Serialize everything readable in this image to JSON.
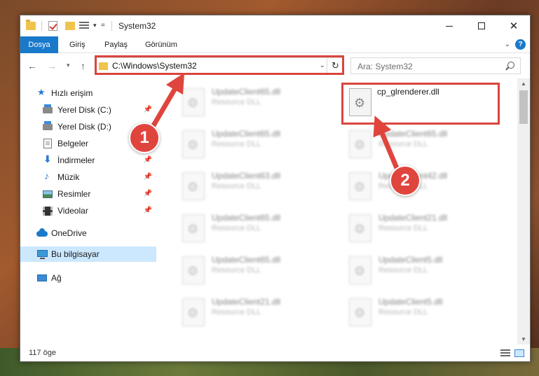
{
  "window": {
    "title": "System32",
    "controls": {
      "minimize": "—",
      "maximize": "☐",
      "close": "✕"
    }
  },
  "ribbon": {
    "tabs": [
      "Dosya",
      "Giriş",
      "Paylaş",
      "Görünüm"
    ]
  },
  "nav": {
    "address": "C:\\Windows\\System32",
    "search_placeholder": "Ara: System32"
  },
  "sidebar": {
    "items": [
      {
        "label": "Hızlı erişim",
        "icon": "star-icon"
      },
      {
        "label": "Yerel Disk (C:)",
        "icon": "drive-icon",
        "pinned": true
      },
      {
        "label": "Yerel Disk (D:)",
        "icon": "drive-icon"
      },
      {
        "label": "Belgeler",
        "icon": "documents-icon",
        "pinned": true
      },
      {
        "label": "İndirmeler",
        "icon": "download-icon",
        "pinned": true
      },
      {
        "label": "Müzik",
        "icon": "music-icon",
        "pinned": true
      },
      {
        "label": "Resimler",
        "icon": "pictures-icon",
        "pinned": true
      },
      {
        "label": "Videolar",
        "icon": "videos-icon",
        "pinned": true
      },
      {
        "label": "OneDrive",
        "icon": "cloud-icon"
      },
      {
        "label": "Bu bilgisayar",
        "icon": "computer-icon",
        "selected": true
      },
      {
        "label": "Ağ",
        "icon": "network-icon"
      }
    ]
  },
  "files": {
    "left_column": [
      {
        "name": "UpdateClient65.dll",
        "type": "Resource DLL"
      },
      {
        "name": "UpdateClient65.dll",
        "type": "Resource DLL"
      },
      {
        "name": "UpdateClient63.dll",
        "type": "Resource DLL"
      },
      {
        "name": "UpdateClient65.dll",
        "type": "Resource DLL"
      },
      {
        "name": "UpdateClient65.dll",
        "type": "Resource DLL"
      },
      {
        "name": "UpdateClient21.dll",
        "type": "Resource DLL"
      }
    ],
    "right_column": [
      {
        "name": "cp_glrenderer.dll",
        "type": ""
      },
      {
        "name": "UpdateClient65.dll",
        "type": "Resource DLL"
      },
      {
        "name": "UpdateClient42.dll",
        "type": "Resource DLL"
      },
      {
        "name": "UpdateClient21.dll",
        "type": "Resource DLL"
      },
      {
        "name": "UpdateClient5.dll",
        "type": "Resource DLL"
      },
      {
        "name": "UpdateClient5.dll",
        "type": "Resource DLL"
      }
    ]
  },
  "status": {
    "item_count": "117 öge"
  },
  "annotations": {
    "step1": "1",
    "step2": "2",
    "color": "#e0453d"
  }
}
